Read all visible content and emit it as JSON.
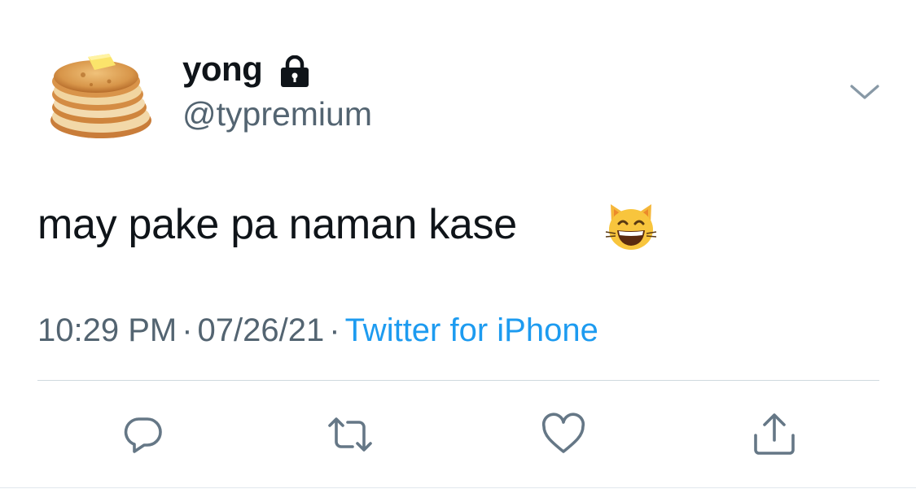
{
  "tweet": {
    "display_name": "yong",
    "handle": "@typremium",
    "text": "may pake pa naman kase",
    "time": "10:29 PM",
    "date": "07/26/21",
    "separator": "·",
    "source": "Twitter for iPhone"
  },
  "icons": {
    "avatar": "pancake-stack-avatar",
    "protected": "lock-icon",
    "menu": "chevron-down-icon",
    "emoji": "grinning-cat-emoji",
    "reply": "reply-icon",
    "retweet": "retweet-icon",
    "like": "heart-icon",
    "share": "share-icon"
  },
  "colors": {
    "text_primary": "#0f1419",
    "text_secondary": "#536471",
    "link": "#1d9bf0",
    "divider": "#cfd9de"
  }
}
